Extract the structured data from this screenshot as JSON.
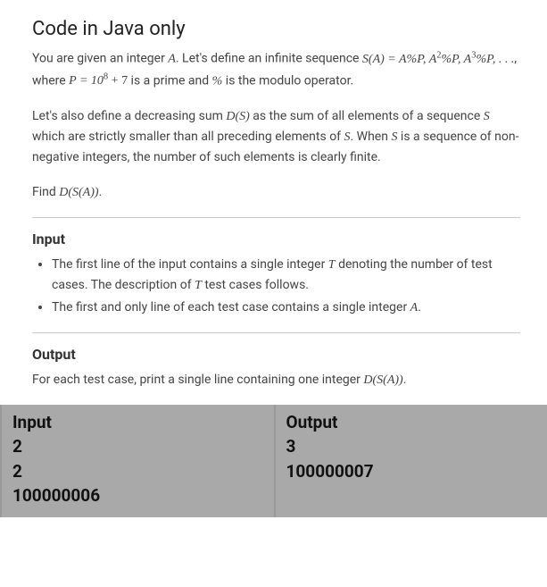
{
  "title": "Code in Java only",
  "para1_a": "You are given an integer ",
  "para1_b": ". Let's define an infinite sequence ",
  "seq_a": "S(A) = A%P, A",
  "seq_b": "%P, A",
  "seq_c": "%P, . . .",
  "para1_c": ", where ",
  "p_eq": "P = 10",
  "p_plus": " + 7",
  "para1_d": " is a prime and ",
  "pct": "%",
  "para1_e": " is the modulo operator.",
  "para2_a": "Let's also define a decreasing sum ",
  "ds": "D(S)",
  "para2_b": " as the sum of all elements of a sequence ",
  "s": "S",
  "para2_c": " which are strictly smaller than all preceding elements of ",
  "para2_d": ". When ",
  "para2_e": " is a sequence of non-negative integers, the number of such elements is clearly finite.",
  "para3_a": "Find ",
  "dsa": "D(S(A))",
  "dot": ".",
  "input_h": "Input",
  "li1_a": "The first line of the input contains a single integer ",
  "t": "T",
  "li1_b": " denoting the number of test cases. The description of ",
  "li1_c": " test cases follows.",
  "li2_a": "The first and only line of each test case contains a single integer ",
  "a": "A",
  "output_h": "Output",
  "para4_a": "For each test case, print a single line containing one integer ",
  "io": {
    "input_head": "Input",
    "output_head": "Output",
    "input_lines": [
      "2",
      "2",
      "100000006"
    ],
    "output_lines": [
      "3",
      "100000007"
    ]
  }
}
